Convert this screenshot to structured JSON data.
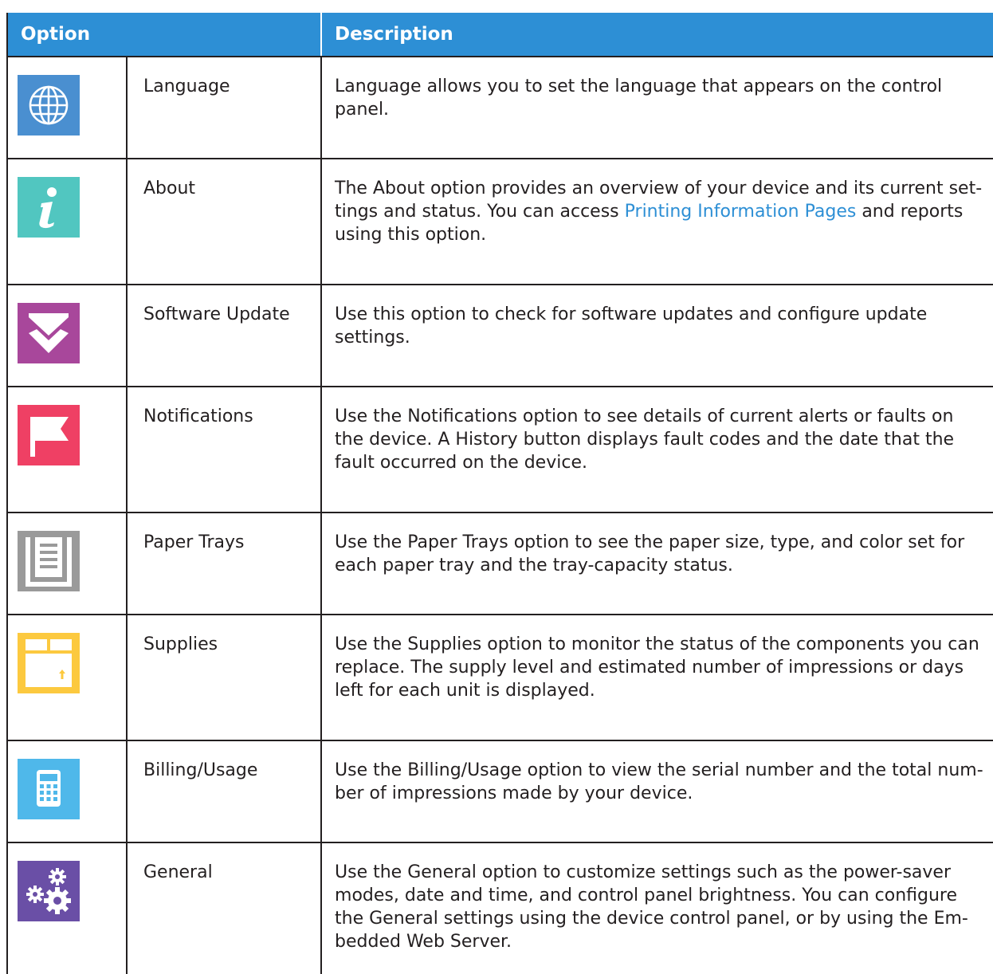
{
  "header": {
    "option": "Option",
    "description": "Description"
  },
  "rows": [
    {
      "icon": "globe-icon",
      "color": "#4a8fd0",
      "name": "Language",
      "description": "Language allows you to set the language that appears on the control panel."
    },
    {
      "icon": "info-icon",
      "color": "#51c6c0",
      "name": "About",
      "description_before": "The About option provides an overview of your device and its current set­tings and status. You can access ",
      "link": "Printing Information Pages",
      "description_after": " and reports using this option."
    },
    {
      "icon": "download-chevron-icon",
      "color": "#a8479b",
      "name": "Software Update",
      "description": "Use this option to check for software updates and configure update settings."
    },
    {
      "icon": "flag-icon",
      "color": "#ef4064",
      "name": "Notifications",
      "description": "Use the Notifications option to see details of current alerts or faults on the device. A History button displays fault codes and the date that the fault occurred on the device."
    },
    {
      "icon": "paper-tray-icon",
      "color": "#9a9a9a",
      "name": "Paper Trays",
      "description": "Use the Paper Trays option to see the paper size, type, and color set for each paper tray and the tray-capacity status."
    },
    {
      "icon": "supply-box-icon",
      "color": "#fcc93f",
      "name": "Supplies",
      "description": "Use the Supplies option to monitor the status of the components you can replace. The supply level and estimated number of impressions or days left for each unit is displayed."
    },
    {
      "icon": "calculator-icon",
      "color": "#4fb8ea",
      "name": "Billing/Usage",
      "description": "Use the Billing/Usage option to view the serial number and the total num­ber of impressions made by your device."
    },
    {
      "icon": "gears-icon",
      "color": "#6a4fa6",
      "name": "General",
      "description": "Use the General option to customize settings such as the power-saver modes, date and time, and control panel brightness. You can configure the General settings using the device control panel, or by using the Em­bedded Web Server."
    }
  ]
}
